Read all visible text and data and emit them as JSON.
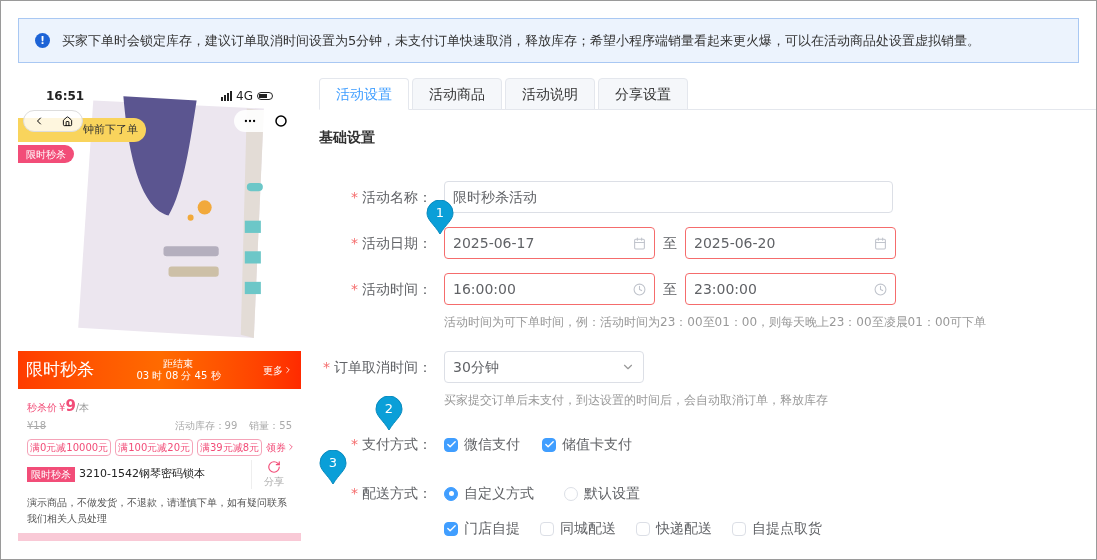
{
  "notice": {
    "icon": "!",
    "text": "买家下单时会锁定库存，建议订单取消时间设置为5分钟，未支付订单快速取消，释放库存；希望小程序端销量看起来更火爆，可以在活动商品处设置虚拟销量。"
  },
  "preview": {
    "time": "16:51",
    "network": "4G",
    "toast": "钟前下了单",
    "tag": "限时秒杀",
    "flash": {
      "title": "限时秒杀",
      "countdown_label": "距结束",
      "countdown": "03 时 08 分 45 秒",
      "more": "更多"
    },
    "price_label": "秒杀价",
    "currency": "¥",
    "price": "9",
    "unit": "/本",
    "original_price": "¥18",
    "stock": "活动库存：99",
    "sales": "销量：55",
    "coupons": [
      "满0元减10000元",
      "满100元减20元",
      "满39元减8元"
    ],
    "coupon_link": "领券",
    "product_tag": "限时秒杀",
    "product_name": "3210-1542钢琴密码锁本",
    "share": "分享",
    "disclaimer": "演示商品，不做发货，不退款，请谨慎下单，如有疑问联系我们相关人员处理"
  },
  "tabs": [
    {
      "label": "活动设置",
      "selected": true
    },
    {
      "label": "活动商品",
      "selected": false
    },
    {
      "label": "活动说明",
      "selected": false
    },
    {
      "label": "分享设置",
      "selected": false
    }
  ],
  "section_title": "基础设置",
  "form": {
    "required_mark": "*",
    "name": {
      "label": "活动名称：",
      "required": true,
      "value": "限时秒杀活动"
    },
    "date": {
      "label": "活动日期：",
      "required": true,
      "start": "2025-06-17",
      "separator": "至",
      "end": "2025-06-20",
      "invalid": true
    },
    "time": {
      "label": "活动时间：",
      "required": true,
      "start": "16:00:00",
      "separator": "至",
      "end": "23:00:00",
      "invalid": true,
      "hint": "活动时间为可下单时间，例：活动时间为23：00至01：00，则每天晚上23：00至凌晨01：00可下单"
    },
    "cancel": {
      "label": "订单取消时间：",
      "required": true,
      "value": "30分钟",
      "hint": "买家提交订单后未支付，到达设置的时间后，会自动取消订单，释放库存"
    },
    "payment": {
      "label": "支付方式：",
      "required": true,
      "options": [
        {
          "label": "微信支付",
          "checked": true
        },
        {
          "label": "储值卡支付",
          "checked": true
        }
      ]
    },
    "delivery": {
      "label": "配送方式：",
      "required": true,
      "modes": [
        {
          "label": "自定义方式",
          "selected": true
        },
        {
          "label": "默认设置",
          "selected": false
        }
      ],
      "options": [
        {
          "label": "门店自提",
          "checked": true
        },
        {
          "label": "同城配送",
          "checked": false
        },
        {
          "label": "快递配送",
          "checked": false
        },
        {
          "label": "自提点取货",
          "checked": false
        }
      ]
    }
  },
  "markers": [
    "1",
    "2",
    "3"
  ]
}
